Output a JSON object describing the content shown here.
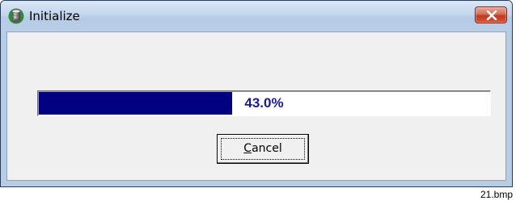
{
  "window": {
    "title": "Initialize",
    "icon": "database-icon",
    "close_icon": "close-icon",
    "accent_close": "#c2391f"
  },
  "progress": {
    "percent": 43.0,
    "label": "43.0%",
    "fill_color": "#000080",
    "text_color": "#1a1a8a"
  },
  "buttons": {
    "cancel_mnemonic": "C",
    "cancel_rest": "ancel"
  },
  "caption": "21.bmp"
}
